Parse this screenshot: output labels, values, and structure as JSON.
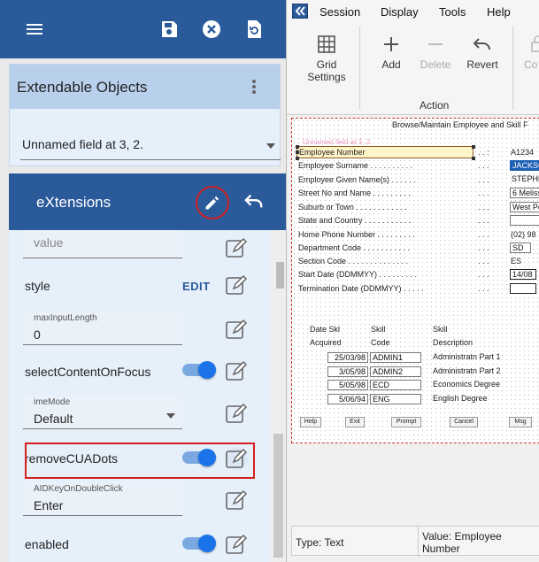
{
  "left_panel": {
    "extendable_objects": {
      "title": "Extendable Objects",
      "selected_field": "Unnamed field at 3, 2."
    },
    "extensions": {
      "title": "eXtensions"
    },
    "properties": [
      {
        "kind": "field",
        "label": "",
        "value": "value"
      },
      {
        "kind": "text",
        "label": "style",
        "action": "EDIT"
      },
      {
        "kind": "field",
        "label": "maxInputLength",
        "value": "0"
      },
      {
        "kind": "toggle",
        "label": "selectContentOnFocus",
        "on": true
      },
      {
        "kind": "select",
        "label": "imeMode",
        "value": "Default"
      },
      {
        "kind": "toggle",
        "label": "removeCUADots",
        "on": true
      },
      {
        "kind": "field",
        "label": "AIDKeyOnDoubleClick",
        "value": "Enter"
      },
      {
        "kind": "toggle",
        "label": "enabled",
        "on": true
      }
    ]
  },
  "menu": [
    "Session",
    "Display",
    "Tools",
    "Help"
  ],
  "ribbon": {
    "buttons": [
      {
        "label": "Grid Settings",
        "line1": "Grid",
        "line2": "Settings",
        "icon": "grid-icon",
        "enabled": true
      },
      {
        "label": "Add",
        "icon": "plus-icon",
        "enabled": true
      },
      {
        "label": "Delete",
        "icon": "minus-icon",
        "enabled": false
      },
      {
        "label": "Revert",
        "icon": "undo-icon",
        "enabled": true
      },
      {
        "label": "Co",
        "icon": "lock-icon",
        "enabled": false
      }
    ],
    "group_label": "Action"
  },
  "screen": {
    "heading": "Browse/Maintain Employee and Skill F",
    "rows": [
      {
        "label": "Employee Number",
        "dots": ". . :",
        "value": "A1234"
      },
      {
        "label": "Employee Surname . . . . . . . . . .",
        "dots": ". . .",
        "value": "JACKSO"
      },
      {
        "label": "Employee Given Name(s) . . . . . .",
        "dots": ". . .",
        "value": "STEPHE"
      },
      {
        "label": "Street No and Name . . . . . . . . .",
        "dots": ". . .",
        "value": "6 Meliss"
      },
      {
        "label": "Suburb or Town . . . . . . . . . . . .",
        "dots": ". . .",
        "value": "West Pe"
      },
      {
        "label": "State and Country . . . . . . . . . . .",
        "dots": ". . .",
        "value": ""
      },
      {
        "label": "Home Phone Number . . . . . . . . .",
        "dots": ". . .",
        "value": "(02) 98"
      },
      {
        "label": "Department Code . . . . . . . . . . .",
        "dots": ". . .",
        "value": "SD"
      },
      {
        "label": "Section Code . . . . . . . . . . . . . .",
        "dots": ". . .",
        "value": "ES"
      },
      {
        "label": "Start Date (DDMMYY) . . . . . . . . .",
        "dots": ". . .",
        "value": "14/08"
      },
      {
        "label": "Termination Date (DDMMYY) . . . . .",
        "dots": ". . .",
        "value": ""
      }
    ],
    "grid_headers": [
      [
        "Date Skl",
        "Acquired"
      ],
      [
        "Skill",
        "Code"
      ],
      [
        "Skill",
        "Description"
      ]
    ],
    "grid_rows": [
      {
        "date": "25/03/98",
        "code": "ADMIN1",
        "desc": "Administratn Part 1"
      },
      {
        "date": "3/05/98",
        "code": "ADMIN2",
        "desc": "Administratn Part 2"
      },
      {
        "date": "5/05/98",
        "code": "ECD",
        "desc": "Economics Degree"
      },
      {
        "date": "5/06/94",
        "code": "ENG",
        "desc": "English Degree"
      }
    ],
    "function_keys": [
      "Help",
      "Exit",
      "Prompt",
      "Cancel",
      "Msg"
    ],
    "ghost_label": "Unnamed field at 3, 2."
  },
  "status": {
    "type": "Type: Text",
    "value": "Value: Employee Number"
  },
  "colors": {
    "primary": "#2a5a9a",
    "highlight_red": "#d32020",
    "toggle_blue": "#1a73e8"
  }
}
